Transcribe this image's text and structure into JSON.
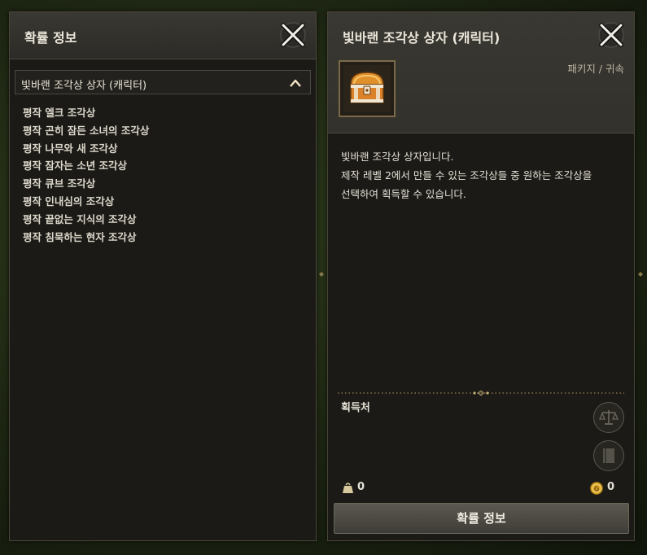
{
  "left_panel": {
    "title": "확률 정보",
    "dropdown": {
      "selected": "빛바랜 조각상 상자 (캐릭터)"
    },
    "items": [
      "평작 엘크 조각상",
      "평작 곤히 잠든 소녀의 조각상",
      "평작 나무와 새 조각상",
      "평작 잠자는 소년 조각상",
      "평작 큐브 조각상",
      "평작 인내심의 조각상",
      "평작 끝없는 지식의 조각상",
      "평작 침묵하는 현자 조각상"
    ]
  },
  "right_panel": {
    "title": "빛바랜 조각상 상자 (캐릭터)",
    "category": "패키지 / 귀속",
    "icon": "treasure-chest-icon",
    "description": [
      "빛바랜 조각상 상자입니다.",
      "제작 레벨 2에서 만들 수 있는 조각상들 중 원하는 조각상을",
      "선택하여 획득할 수 있습니다."
    ],
    "acquire_label": "획득처",
    "weight": "0",
    "gold": "0",
    "probability_button": "확률 정보"
  },
  "colors": {
    "panel_bg": "#1b1a17",
    "header_bg": "#3a3832",
    "accent_gold": "#d8a72a"
  }
}
